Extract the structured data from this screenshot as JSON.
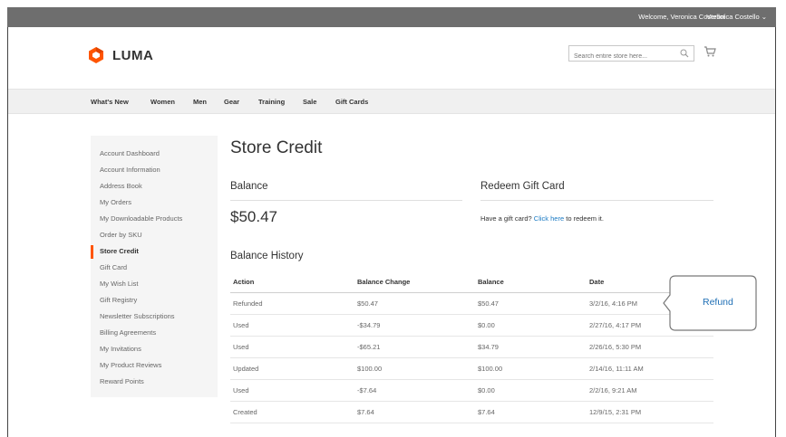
{
  "header": {
    "welcome": "Welcome, Veronica Costello!",
    "customer_menu": "Veronica Costello",
    "logo_text": "LUMA",
    "search_placeholder": "Search entire store here...",
    "brand_color": "#ff5501"
  },
  "nav": [
    "What's New",
    "Women",
    "Men",
    "Gear",
    "Training",
    "Sale",
    "Gift Cards"
  ],
  "sidebar": {
    "items": [
      "Account Dashboard",
      "Account Information",
      "Address Book",
      "My Orders",
      "My Downloadable Products",
      "Order by SKU",
      "Store Credit",
      "Gift Card",
      "My Wish List",
      "Gift Registry",
      "Newsletter Subscriptions",
      "Billing Agreements",
      "My Invitations",
      "My Product Reviews",
      "Reward Points"
    ],
    "active": "Store Credit"
  },
  "page": {
    "title": "Store Credit",
    "balance_heading": "Balance",
    "balance_amount": "$50.47",
    "redeem_heading": "Redeem Gift Card",
    "gift_prefix": "Have a gift card?",
    "gift_link": "Click here",
    "gift_suffix": "to redeem it.",
    "history_heading": "Balance History"
  },
  "history": {
    "columns": [
      "Action",
      "Balance Change",
      "Balance",
      "Date"
    ],
    "rows": [
      [
        "Refunded",
        "$50.47",
        "$50.47",
        "3/2/16, 4:16 PM"
      ],
      [
        "Used",
        "-$34.79",
        "$0.00",
        "2/27/16, 4:17 PM"
      ],
      [
        "Used",
        "-$65.21",
        "$34.79",
        "2/26/16, 5:30 PM"
      ],
      [
        "Updated",
        "$100.00",
        "$100.00",
        "2/14/16, 11:11 AM"
      ],
      [
        "Used",
        "-$7.64",
        "$0.00",
        "2/2/16, 9:21 AM"
      ],
      [
        "Created",
        "$7.64",
        "$7.64",
        "12/9/15, 2:31 PM"
      ]
    ]
  },
  "callout": {
    "text": "Refund"
  }
}
